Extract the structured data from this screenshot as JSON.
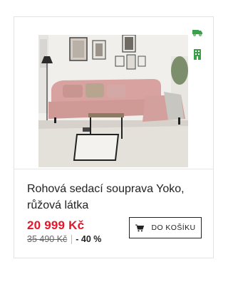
{
  "product": {
    "title": "Rohová sedací souprava Yoko, růžová látka",
    "price": "20 999 Kč",
    "old_price": "35 490 Kč",
    "discount": "- 40 %",
    "cart_label": "DO KOŠÍKU"
  },
  "icons": {
    "delivery": "delivery-truck-icon",
    "store": "store-availability-icon",
    "cart": "shopping-cart-icon"
  },
  "colors": {
    "price_red": "#e3172b",
    "badge_green": "#3aa14a",
    "sofa_pink": "#d9a3a3"
  }
}
